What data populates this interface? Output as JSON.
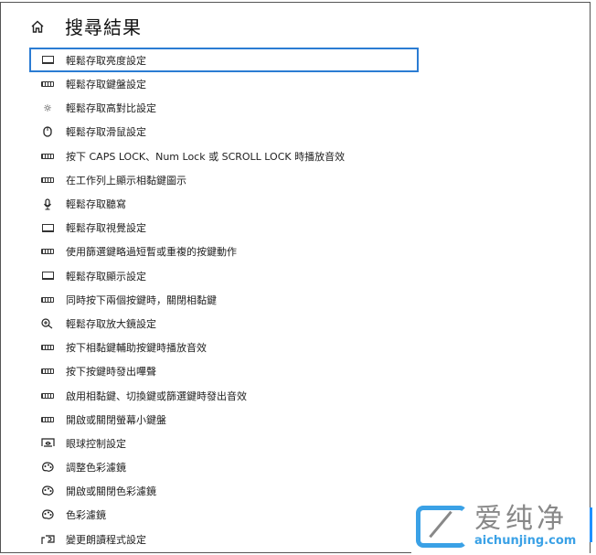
{
  "header": {
    "title": "搜尋結果",
    "icon": "home-icon"
  },
  "results": [
    {
      "label": "輕鬆存取亮度設定",
      "icon": "monitor"
    },
    {
      "label": "輕鬆存取鍵盤設定",
      "icon": "keyboard"
    },
    {
      "label": "輕鬆存取高對比設定",
      "icon": "contrast"
    },
    {
      "label": "輕鬆存取滑鼠設定",
      "icon": "mouse"
    },
    {
      "label": "按下 CAPS LOCK、Num Lock 或 SCROLL LOCK 時播放音效",
      "icon": "keyboard"
    },
    {
      "label": "在工作列上顯示相黏鍵圖示",
      "icon": "keyboard"
    },
    {
      "label": "輕鬆存取聽寫",
      "icon": "microphone"
    },
    {
      "label": "輕鬆存取視覺設定",
      "icon": "monitor"
    },
    {
      "label": "使用篩選鍵略過短暫或重複的按鍵動作",
      "icon": "keyboard"
    },
    {
      "label": "輕鬆存取顯示設定",
      "icon": "monitor"
    },
    {
      "label": "同時按下兩個按鍵時，關閉相黏鍵",
      "icon": "keyboard"
    },
    {
      "label": "輕鬆存取放大鏡設定",
      "icon": "magnifier"
    },
    {
      "label": "按下相黏鍵輔助按鍵時播放音效",
      "icon": "keyboard"
    },
    {
      "label": "按下按鍵時發出嗶聲",
      "icon": "keyboard"
    },
    {
      "label": "啟用相黏鍵、切換鍵或篩選鍵時發出音效",
      "icon": "keyboard"
    },
    {
      "label": "開啟或關閉螢幕小鍵盤",
      "icon": "keyboard"
    },
    {
      "label": "眼球控制設定",
      "icon": "eye-control"
    },
    {
      "label": "調整色彩濾鏡",
      "icon": "palette"
    },
    {
      "label": "開啟或關閉色彩濾鏡",
      "icon": "palette"
    },
    {
      "label": "色彩濾鏡",
      "icon": "palette"
    },
    {
      "label": "變更朗讀程式設定",
      "icon": "narrator"
    }
  ],
  "watermark": {
    "cn": "爱纯净",
    "en": "aichunjing.com"
  },
  "colors": {
    "focus": "#2b7cd3",
    "watermark_blue": "#3aa1e6"
  }
}
